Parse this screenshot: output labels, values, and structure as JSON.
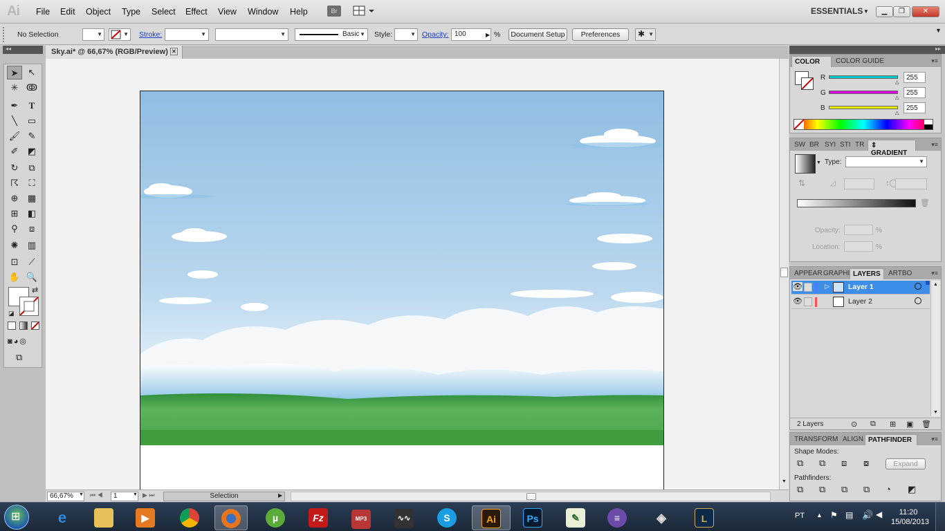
{
  "app": {
    "logo": "Ai",
    "workspace": "ESSENTIALS",
    "bridge_button": "Br"
  },
  "menu": [
    "File",
    "Edit",
    "Object",
    "Type",
    "Select",
    "Effect",
    "View",
    "Window",
    "Help"
  ],
  "control_bar": {
    "selection_status": "No Selection",
    "stroke_label": "Stroke:",
    "stroke_profile": "Basic",
    "style_label": "Style:",
    "opacity_label": "Opacity:",
    "opacity_value": "100",
    "opacity_unit": "%",
    "document_setup": "Document Setup",
    "preferences": "Preferences"
  },
  "document": {
    "tab_title": "Sky.ai* @ 66,67% (RGB/Preview)",
    "close_glyph": "✕"
  },
  "status_bar": {
    "zoom": "66,67%",
    "artboard_number": "1",
    "status": "Selection"
  },
  "color_panel": {
    "tabs": [
      "COLOR",
      "COLOR GUIDE"
    ],
    "channels": [
      {
        "name": "R",
        "value": "255",
        "color": "#00c8c8"
      },
      {
        "name": "G",
        "value": "255",
        "color": "#e000e0"
      },
      {
        "name": "B",
        "value": "255",
        "color": "#e6e600"
      }
    ]
  },
  "gradient_panel": {
    "tabs": [
      "SW",
      "BR",
      "SYI",
      "STI",
      "TR",
      "GRADIENT"
    ],
    "type_label": "Type:",
    "opacity_label": "Opacity:",
    "location_label": "Location:",
    "percent": "%"
  },
  "layers_panel": {
    "tabs": [
      "APPEAR",
      "GRAPHI",
      "LAYERS",
      "ARTBO"
    ],
    "layers": [
      {
        "name": "Layer 1",
        "selected": true,
        "color": "#4f7fff"
      },
      {
        "name": "Layer 2",
        "selected": false,
        "color": "#ff4f4f"
      }
    ],
    "count": "2 Layers"
  },
  "pathfinder_panel": {
    "tabs": [
      "TRANSFORM",
      "ALIGN",
      "PATHFINDER"
    ],
    "shape_modes": "Shape Modes:",
    "expand": "Expand",
    "pathfinders": "Pathfinders:"
  },
  "taskbar": {
    "lang": "PT",
    "time": "11:20",
    "date": "15/08/2013",
    "apps": [
      "internet-explorer",
      "file-explorer",
      "media-player",
      "chrome",
      "firefox",
      "utorrent",
      "filezilla",
      "mp3-converter",
      "audio-editor",
      "skype",
      "illustrator",
      "photoshop",
      "notepad",
      "eclipse",
      "unity",
      "league-of-legends"
    ],
    "illustrator_label": "Ai",
    "photoshop_label": "Ps"
  },
  "colors": {
    "selection_blue": "#3d8ee8",
    "sky_top": "#8fbde2",
    "grass": "#4aa54a"
  }
}
